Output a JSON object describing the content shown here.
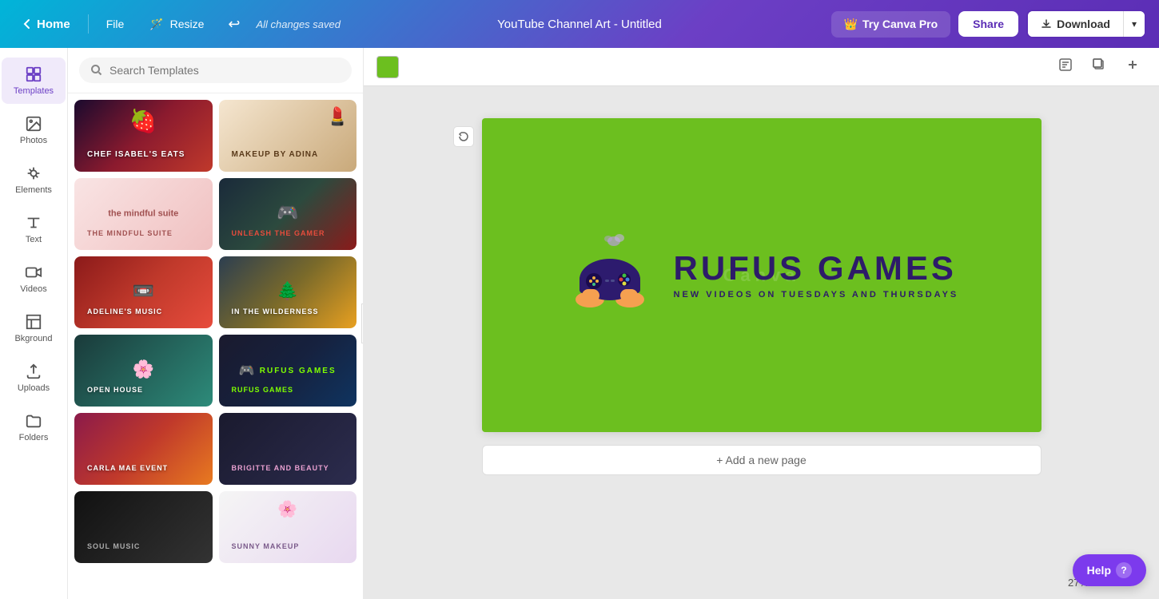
{
  "topbar": {
    "home_label": "Home",
    "file_label": "File",
    "resize_label": "Resize",
    "saved_status": "All changes saved",
    "title": "YouTube Channel Art - Untitled",
    "try_pro_label": "Try Canva Pro",
    "share_label": "Share",
    "download_label": "Download"
  },
  "sidebar": {
    "items": [
      {
        "id": "templates",
        "label": "Templates",
        "icon": "grid-icon"
      },
      {
        "id": "photos",
        "label": "Photos",
        "icon": "photo-icon"
      },
      {
        "id": "elements",
        "label": "Elements",
        "icon": "elements-icon"
      },
      {
        "id": "text",
        "label": "Text",
        "icon": "text-icon"
      },
      {
        "id": "videos",
        "label": "Videos",
        "icon": "video-icon"
      },
      {
        "id": "background",
        "label": "Bkground",
        "icon": "background-icon"
      },
      {
        "id": "uploads",
        "label": "Uploads",
        "icon": "upload-icon"
      },
      {
        "id": "folders",
        "label": "Folders",
        "icon": "folder-icon"
      }
    ]
  },
  "templates_panel": {
    "search_placeholder": "Search Templates",
    "templates": [
      {
        "id": 1,
        "style": "tpl-berry",
        "label": "Chef Isabel's Eats",
        "show_label": true
      },
      {
        "id": 2,
        "style": "tpl-makeup",
        "label": "Makeup By Adina",
        "show_label": true
      },
      {
        "id": 3,
        "style": "tpl-blog",
        "label": "The Mindful Suite",
        "show_label": true
      },
      {
        "id": 4,
        "style": "tpl-gamer",
        "label": "Unleash The Gamer",
        "show_label": true
      },
      {
        "id": 5,
        "style": "tpl-cassette",
        "label": "Adeline's Music",
        "show_label": true
      },
      {
        "id": 6,
        "style": "tpl-nature",
        "label": "In The Wilderness",
        "show_label": true
      },
      {
        "id": 7,
        "style": "tpl-flowers",
        "label": "Open House",
        "show_label": true
      },
      {
        "id": 8,
        "style": "tpl-rufus",
        "label": "Rufus Games",
        "show_label": true
      },
      {
        "id": 9,
        "style": "tpl-festival",
        "label": "Carla Mae Event",
        "show_label": true
      },
      {
        "id": 10,
        "style": "tpl-beauty2",
        "label": "Brigitte and Beauty",
        "show_label": true
      },
      {
        "id": 11,
        "style": "tpl-dark",
        "label": "Soul Music",
        "show_label": true
      },
      {
        "id": 12,
        "style": "tpl-makeup2",
        "label": "Sunny Makeup",
        "show_label": true
      }
    ]
  },
  "canvas": {
    "bg_color": "#6cbf1f",
    "design_title": "RUFUS GAMES",
    "design_subtitle": "NEW VIDEOS ON TUESDAYS AND THURSDAYS",
    "watermark": "Canva",
    "add_page_label": "+ Add a new page",
    "zoom_level": "27%"
  },
  "canvas_toolbar": {
    "color_swatch": "#6cbf1f"
  },
  "help": {
    "label": "Help",
    "icon": "?"
  }
}
